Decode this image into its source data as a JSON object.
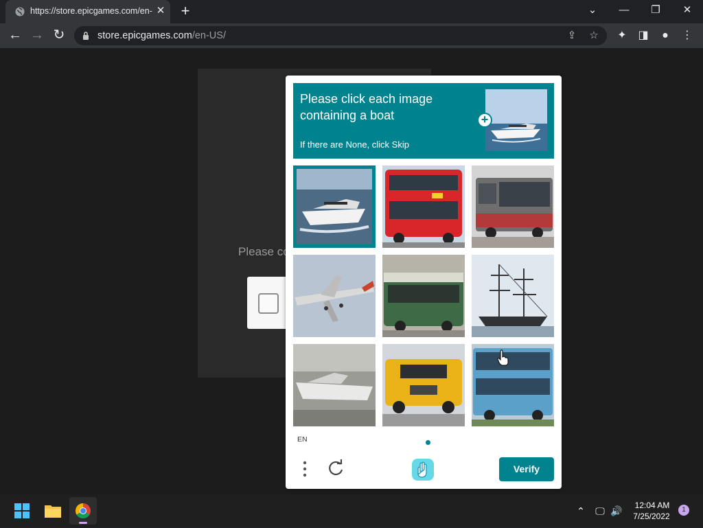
{
  "browser": {
    "tab_title": "https://store.epicgames.com/en-",
    "url_host": "store.epicgames.com",
    "url_path": "/en-US/"
  },
  "page": {
    "background_text": "Please co"
  },
  "captcha": {
    "prompt_main": "Please click each image containing a boat",
    "prompt_sub": "If there are None, click Skip",
    "language": "EN",
    "verify_label": "Verify",
    "accent_color": "#00838f",
    "tiles": [
      {
        "subject": "yacht",
        "selected": true
      },
      {
        "subject": "red double-decker bus",
        "selected": false
      },
      {
        "subject": "red bus",
        "selected": false
      },
      {
        "subject": "airplane",
        "selected": false
      },
      {
        "subject": "green bus",
        "selected": false
      },
      {
        "subject": "sailing ship",
        "selected": false
      },
      {
        "subject": "motorboat",
        "selected": false
      },
      {
        "subject": "yellow school bus",
        "selected": false
      },
      {
        "subject": "blue double-decker bus",
        "selected": false
      }
    ]
  },
  "taskbar": {
    "time": "12:04 AM",
    "date": "7/25/2022",
    "notification_count": "1"
  }
}
